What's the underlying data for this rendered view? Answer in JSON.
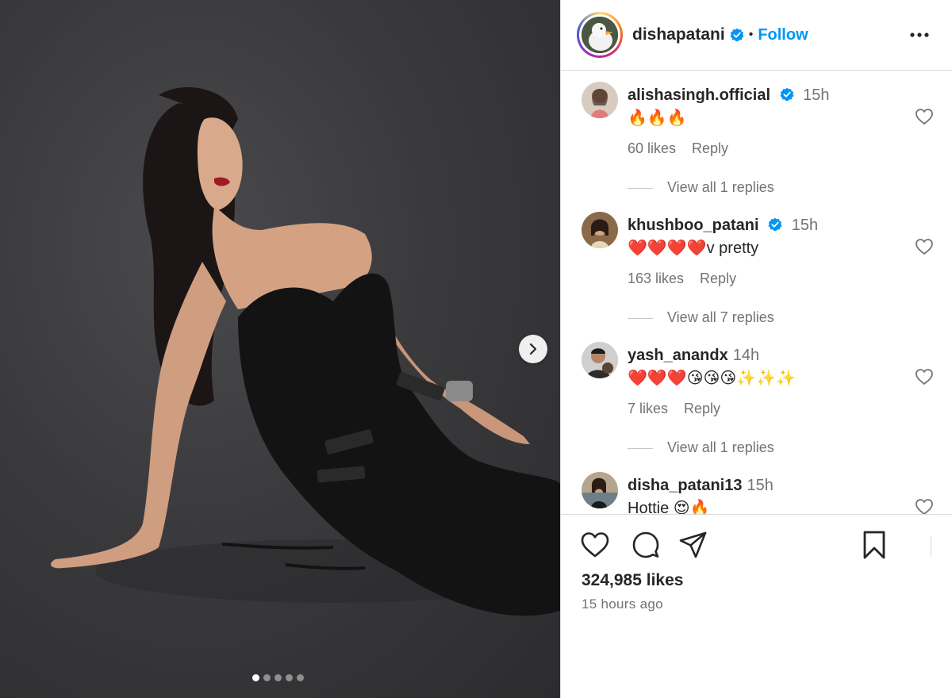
{
  "post": {
    "author": "dishapatani",
    "follow_label": "Follow",
    "separator": "•",
    "likes": "324,985 likes",
    "time_ago": "15 hours ago",
    "carousel": {
      "count": 5,
      "active_index": 0
    }
  },
  "comments": [
    {
      "user": "alishasingh.official",
      "verified": true,
      "time": "15h",
      "text": "🔥🔥🔥",
      "likes": "60 likes",
      "reply_label": "Reply",
      "view_replies": "View all 1 replies"
    },
    {
      "user": "khushboo_patani",
      "verified": true,
      "time": "15h",
      "text": "❤️❤️❤️❤️v pretty",
      "likes": "163 likes",
      "reply_label": "Reply",
      "view_replies": "View all 7 replies"
    },
    {
      "user": "yash_anandx",
      "verified": false,
      "time": "14h",
      "text": "❤️❤️❤️😘😘😘✨✨✨",
      "likes": "7 likes",
      "reply_label": "Reply",
      "view_replies": "View all 1 replies"
    },
    {
      "user": "disha_patani13",
      "verified": false,
      "time": "15h",
      "text": "Hottie 😍🔥"
    }
  ],
  "icons": {
    "header": [
      "verified-badge-icon",
      "more-options-icon"
    ],
    "actions": [
      "heart-icon",
      "comment-icon",
      "share-icon",
      "bookmark-icon"
    ],
    "media": [
      "chevron-right-icon"
    ]
  },
  "colors": {
    "accent": "#0095f6",
    "text": "#262626",
    "muted": "#737373",
    "divider": "#dbdbdb",
    "photo_bg": "#3a3a3d"
  }
}
